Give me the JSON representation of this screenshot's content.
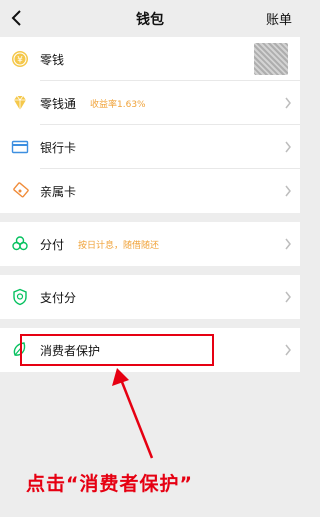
{
  "header": {
    "title": "钱包",
    "right_label": "账单"
  },
  "group1": [
    {
      "label": "零钱",
      "icon": "coin-icon"
    },
    {
      "label": "零钱通",
      "sub": "收益率1.63%",
      "icon": "diamond-icon"
    },
    {
      "label": "银行卡",
      "icon": "bank-card-icon"
    },
    {
      "label": "亲属卡",
      "icon": "family-card-icon"
    }
  ],
  "group2": {
    "label": "分付",
    "sub": "按日计息，随借随还",
    "icon": "clover-icon"
  },
  "group3": {
    "label": "支付分",
    "icon": "shield-score-icon"
  },
  "group4": {
    "label": "消费者保护",
    "icon": "leaf-protect-icon"
  },
  "annotation": {
    "caption": "点击“消费者保护”",
    "color": "#e60012"
  },
  "colors": {
    "accent_green": "#07c160",
    "accent_gold": "#f0a33a",
    "annotation_red": "#e60012"
  }
}
